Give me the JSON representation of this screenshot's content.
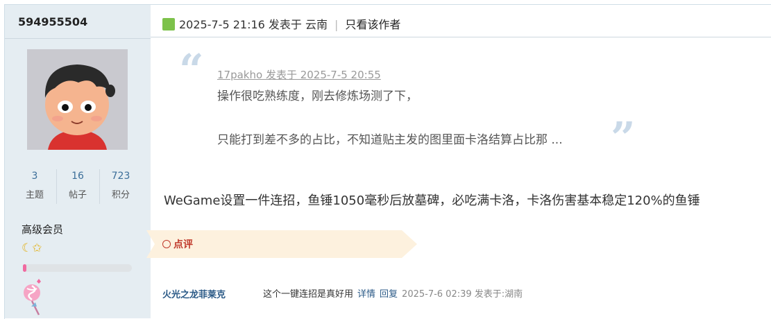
{
  "user": {
    "name": "594955504",
    "stats": [
      {
        "value": "3",
        "label": "主题"
      },
      {
        "value": "16",
        "label": "帖子"
      },
      {
        "value": "723",
        "label": "积分"
      }
    ],
    "level": "高级会员",
    "medals": "☾✩",
    "progress": 0.03
  },
  "post": {
    "header": {
      "time": "2025-7-5 21:16 发表于 云南",
      "only_author": "只看该作者"
    },
    "quote": {
      "meta": "17pakho 发表于 2025-7-5 20:55",
      "line1": "操作很吃熟练度，刚去修炼场测了下，",
      "line2": "只能打到差不多的占比，不知道贴主发的图里面卡洛结算占比那 ..."
    },
    "body": "WeGame设置一件连招，鱼锤1050毫秒后放墓碑，必吃满卡洛，卡洛伤害基本稳定120%的鱼锤"
  },
  "comment": {
    "label": "点评",
    "user": "火光之龙菲莱克",
    "text": "这个一键连招是真好用",
    "detail": "详情",
    "reply": "回复",
    "time": "2025-7-6 02:39 发表于:湖南"
  },
  "colors": {
    "sidebar_bg": "#e5edf2",
    "link": "#2b5a87",
    "comment_accent": "#c0392b",
    "comment_bar": "#fdf1de"
  }
}
